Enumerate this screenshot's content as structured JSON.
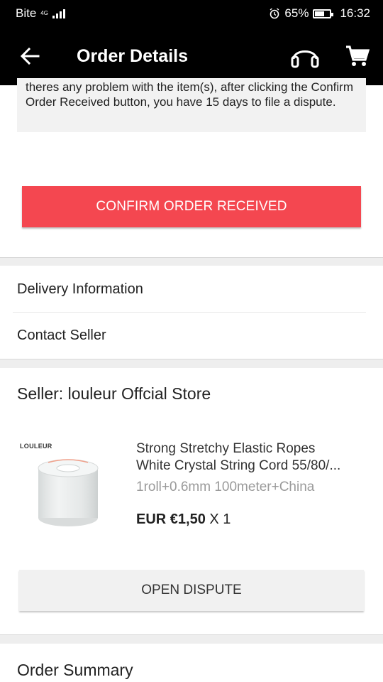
{
  "status_bar": {
    "carrier": "Bite",
    "network": "4G",
    "battery_percent": "65%",
    "battery_level": 0.65,
    "time": "16:32",
    "alarm_icon": "alarm-clock-icon"
  },
  "app_bar": {
    "title": "Order Details",
    "back_icon": "arrow-left-icon",
    "support_icon": "headset-icon",
    "cart_icon": "shopping-cart-icon"
  },
  "notice": {
    "text": "theres any problem with the item(s), after clicking the Confirm Order Received button, you have 15 days to file a dispute."
  },
  "confirm_button": {
    "label": "CONFIRM ORDER RECEIVED",
    "color": "#f44750"
  },
  "menu": {
    "delivery_information": "Delivery Information",
    "contact_seller": "Contact Seller"
  },
  "seller": {
    "title": "Seller: louleur Offcial Store"
  },
  "product": {
    "brand_tag": "LOULEUR",
    "name_line1": "Strong Stretchy Elastic Ropes",
    "name_line2": "White Crystal String Cord 55/80/...",
    "variant": "1roll+0.6mm 100meter+China",
    "price": "EUR €1,50",
    "quantity": "X 1"
  },
  "dispute_button": {
    "label": "OPEN DISPUTE"
  },
  "order_summary": {
    "title": "Order Summary"
  }
}
